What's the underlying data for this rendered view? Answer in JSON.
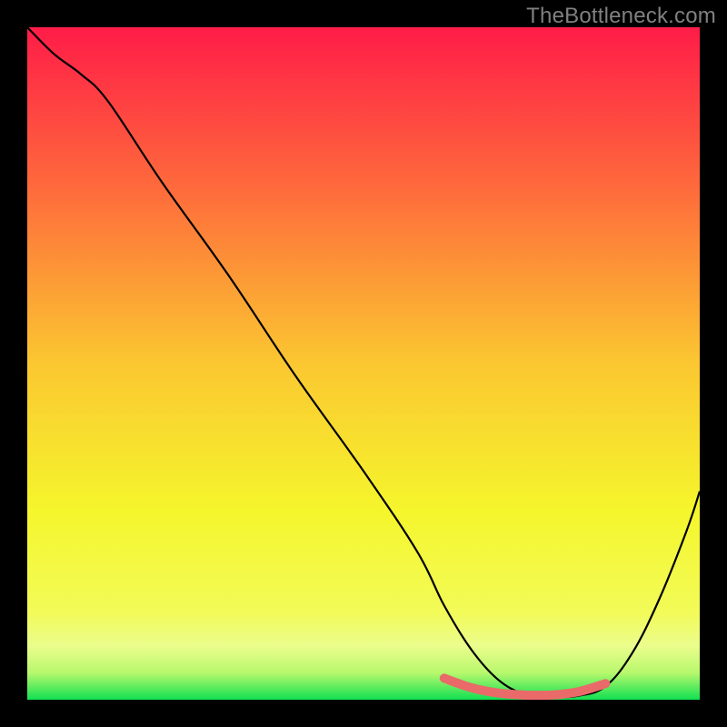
{
  "watermark": "TheBottleneck.com",
  "chart_data": {
    "type": "line",
    "title": "",
    "xlabel": "",
    "ylabel": "",
    "xlim": [
      0,
      100
    ],
    "ylim": [
      0,
      100
    ],
    "grid": false,
    "legend": false,
    "series": [
      {
        "name": "curve",
        "color": "#000000",
        "x": [
          0,
          4,
          8,
          12,
          20,
          30,
          40,
          50,
          58,
          62,
          66,
          70,
          74,
          78,
          82,
          86,
          90,
          94,
          98,
          100
        ],
        "values": [
          100,
          96,
          93,
          89,
          77,
          63,
          48,
          34,
          22,
          14,
          7.5,
          3.0,
          0.8,
          0.4,
          0.6,
          2.0,
          7.0,
          15,
          25,
          31
        ]
      }
    ],
    "highlight": {
      "name": "bottom-band",
      "color": "#E96A69",
      "x": [
        62,
        66,
        70,
        74,
        78,
        82,
        86
      ],
      "values": [
        3.2,
        1.8,
        1.0,
        0.7,
        0.7,
        1.2,
        2.4
      ]
    },
    "gradient_stops": [
      {
        "offset": 0.0,
        "color": "#FF1C48"
      },
      {
        "offset": 0.25,
        "color": "#FE6E3B"
      },
      {
        "offset": 0.5,
        "color": "#FBC731"
      },
      {
        "offset": 0.72,
        "color": "#F5F62C"
      },
      {
        "offset": 0.87,
        "color": "#F2FB58"
      },
      {
        "offset": 0.92,
        "color": "#EBFD8C"
      },
      {
        "offset": 0.96,
        "color": "#B7F86D"
      },
      {
        "offset": 1.0,
        "color": "#11E052"
      }
    ]
  }
}
